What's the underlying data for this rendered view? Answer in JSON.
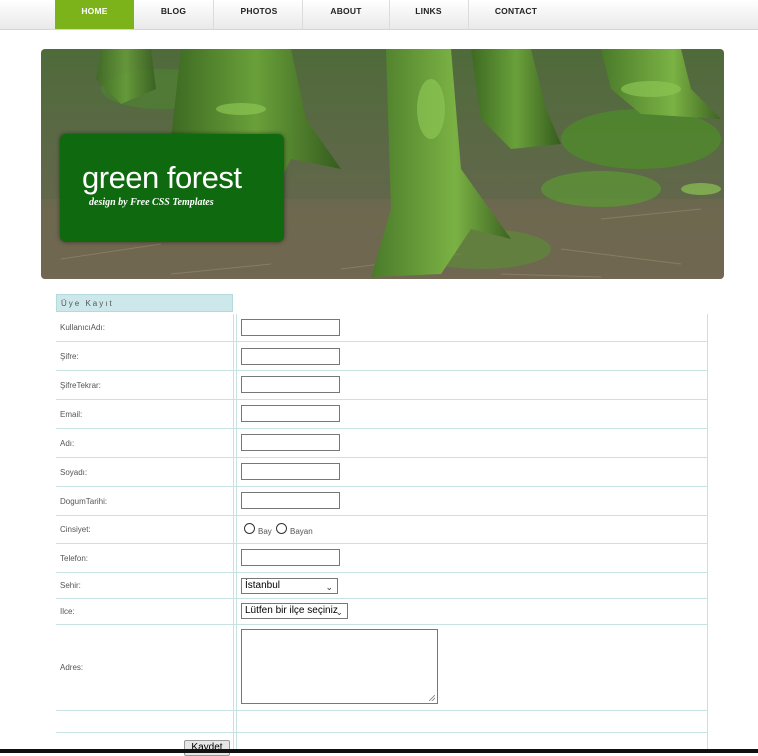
{
  "nav": {
    "items": [
      {
        "label": "HOME",
        "active": true
      },
      {
        "label": "BLOG",
        "active": false
      },
      {
        "label": "PHOTOS",
        "active": false
      },
      {
        "label": "ABOUT",
        "active": false
      },
      {
        "label": "LINKS",
        "active": false
      },
      {
        "label": "CONTACT",
        "active": false
      }
    ],
    "active_color": "#7cb21a"
  },
  "header": {
    "title": "green forest",
    "subtitle": "design by Free CSS Templates",
    "logo_color": "#0f6a0f"
  },
  "form": {
    "title": "Üye Kayıt",
    "fields": {
      "kullanici": "KullanıcıAdı:",
      "sifre": "Şifre:",
      "sifre_tekrar": "ŞifreTekrar:",
      "email": "Email:",
      "adi": "Adı:",
      "soyadi": "Soyadı:",
      "dogum": "DogumTarihi:",
      "cinsiyet": "Cinsiyet:",
      "telefon": "Telefon:",
      "sehir": "Sehir:",
      "ilce": "Ilce:",
      "adres": "Adres:"
    },
    "gender_options": [
      "Bay",
      "Bayan"
    ],
    "sehir_value": "İstanbul",
    "ilce_value": "Lütfen bir ilçe seçiniz",
    "submit_label": "Kaydet"
  }
}
